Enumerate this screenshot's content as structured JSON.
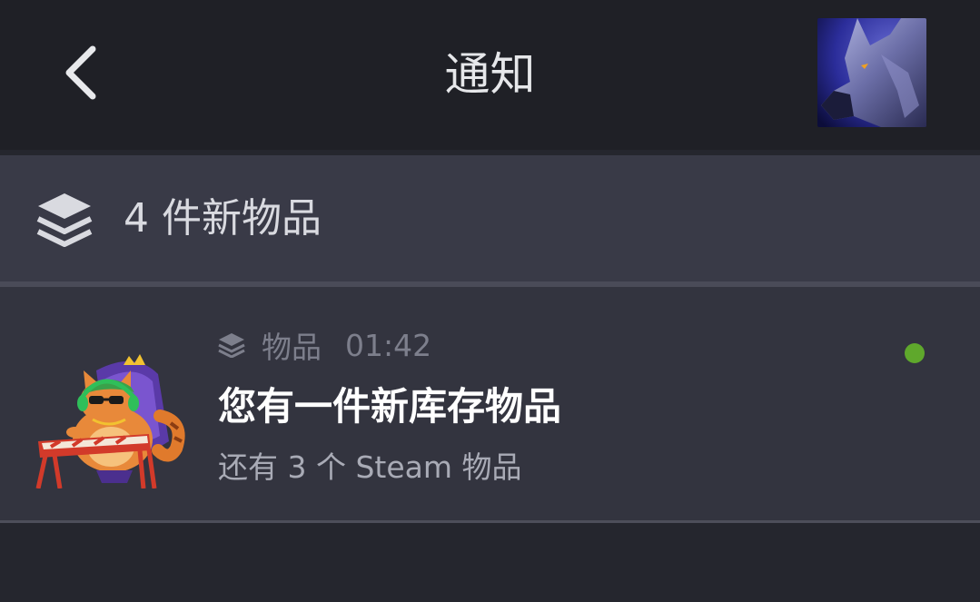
{
  "header": {
    "title": "通知",
    "back_icon": "chevron-left-icon",
    "avatar_icon": "wolf-avatar"
  },
  "group": {
    "icon": "stack-layers-icon",
    "title": "4 件新物品"
  },
  "notification": {
    "category_icon": "stack-layers-icon",
    "category": "物品",
    "time": "01:42",
    "title": "您有一件新库存物品",
    "subtitle": "还有 3 个 Steam 物品",
    "unread": true,
    "unread_color": "#5fa82c"
  }
}
